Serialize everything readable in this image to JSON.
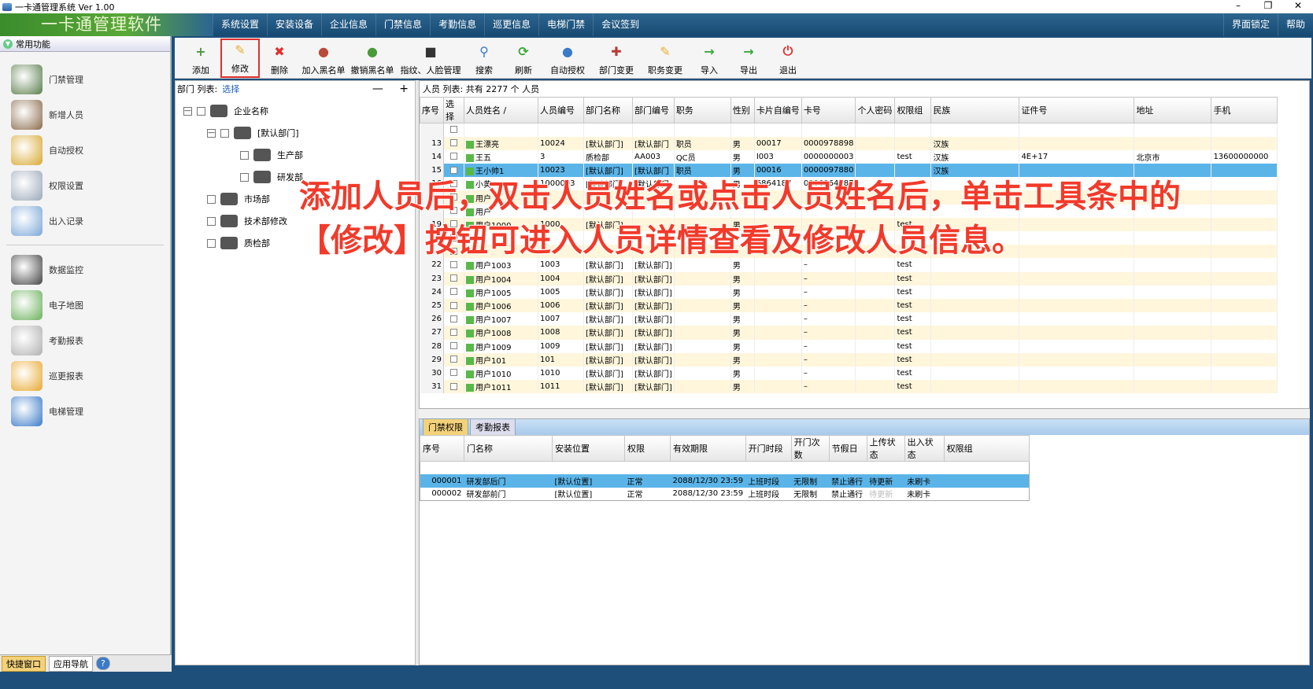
{
  "window": {
    "title": "一卡通管理系统  Ver 1.00",
    "controls": [
      "–",
      "❐",
      "✕"
    ]
  },
  "menubar": {
    "brand": "一卡通管理软件",
    "items": [
      "系统设置",
      "安装设备",
      "企业信息",
      "门禁信息",
      "考勤信息",
      "巡更信息",
      "电梯门禁",
      "会议签到"
    ],
    "right_items": [
      "界面锁定",
      "帮助"
    ]
  },
  "left_panel": {
    "header": "常用功能",
    "items": [
      {
        "label": "门禁管理",
        "icon": "door-access-icon",
        "color": "#5a7d4a"
      },
      {
        "label": "新增人员",
        "icon": "new-person-icon",
        "color": "#8a6a4a"
      },
      {
        "label": "自动授权",
        "icon": "card-icon",
        "color": "#d8a830"
      },
      {
        "label": "权限设置",
        "icon": "permission-icon",
        "color": "#9aa8b8"
      },
      {
        "label": "出入记录",
        "icon": "magnifier-icon",
        "color": "#7aa6d8"
      }
    ],
    "items2": [
      {
        "label": "数据监控",
        "icon": "camera-icon",
        "color": "#444444"
      },
      {
        "label": "电子地图",
        "icon": "map-icon",
        "color": "#6ab05a"
      },
      {
        "label": "考勤报表",
        "icon": "clock-icon",
        "color": "#b0b0b0"
      },
      {
        "label": "巡更报表",
        "icon": "patrol-icon",
        "color": "#e8a830"
      },
      {
        "label": "电梯管理",
        "icon": "elevator-icon",
        "color": "#3a7ac8"
      }
    ],
    "bottom_tabs": [
      "快捷窗口",
      "应用导航",
      "?"
    ]
  },
  "toolbar": {
    "buttons": [
      {
        "label": "添加",
        "icon": "add-person-icon",
        "color": "#4a9a3a"
      },
      {
        "label": "修改",
        "icon": "edit-pencil-icon",
        "color": "#e8b030"
      },
      {
        "label": "删除",
        "icon": "delete-icon",
        "color": "#e03030"
      },
      {
        "label": "加入黑名单",
        "icon": "blacklist-add-icon",
        "color": "#b84a3a"
      },
      {
        "label": "撤销黑名单",
        "icon": "blacklist-remove-icon",
        "color": "#4a9a3a"
      },
      {
        "label": "指纹、人脸管理",
        "icon": "fingerprint-icon",
        "color": "#333333"
      },
      {
        "label": "搜索",
        "icon": "search-icon",
        "color": "#3a7ac8"
      },
      {
        "label": "刷新",
        "icon": "refresh-icon",
        "color": "#3aa83a"
      },
      {
        "label": "自动授权",
        "icon": "auto-auth-icon",
        "color": "#3a7ac8"
      },
      {
        "label": "部门变更",
        "icon": "dept-change-icon",
        "color": "#b83a3a"
      },
      {
        "label": "职务变更",
        "icon": "job-change-icon",
        "color": "#e8b030"
      },
      {
        "label": "导入",
        "icon": "import-icon",
        "color": "#3aa83a"
      },
      {
        "label": "导出",
        "icon": "export-icon",
        "color": "#3aa83a"
      },
      {
        "label": "退出",
        "icon": "power-icon",
        "color": "#e03030"
      }
    ]
  },
  "dept_panel": {
    "label": "部门 列表:",
    "select": "选择",
    "collapse": "—",
    "expand": "+",
    "root": "企业名称",
    "nodes": [
      {
        "label": "[默认部门]",
        "level": 1,
        "exp": "—"
      },
      {
        "label": "生产部",
        "level": 2
      },
      {
        "label": "研发部",
        "level": 2
      },
      {
        "label": "市场部",
        "level": 1
      },
      {
        "label": "技术部修改",
        "level": 1
      },
      {
        "label": "质检部",
        "level": 1
      }
    ]
  },
  "grid": {
    "caption": "人员 列表:    共有 2277  个 人员",
    "columns": [
      "序号",
      "选择",
      "人员姓名 /",
      "人员编号",
      "部门名称",
      "部门编号",
      "职务",
      "性别",
      "卡片自编号",
      "卡号",
      "个人密码",
      "权限组",
      "民族",
      "证件号",
      "地址",
      "手机"
    ],
    "rows": [
      {
        "seq": "",
        "name": "",
        "no": "",
        "dept": "",
        "deptno": "",
        "job": "",
        "sex": "",
        "cardself": "",
        "card": "",
        "pwd": "",
        "group": "",
        "nation": "",
        "id": "",
        "addr": "",
        "phone": "",
        "blank": true
      },
      {
        "seq": "13",
        "name": "王漂亮",
        "no": "10024",
        "dept": "[默认部门]",
        "deptno": "[默认部门",
        "job": "职员",
        "sex": "男",
        "cardself": "00017",
        "card": "0000978898",
        "pwd": "",
        "group": "",
        "nation": "汉族",
        "id": "",
        "addr": "",
        "phone": ""
      },
      {
        "seq": "14",
        "name": "王五",
        "no": "3",
        "dept": "质检部",
        "deptno": "AA003",
        "job": "QC员",
        "sex": "男",
        "cardself": "I003",
        "card": "0000000003",
        "pwd": "",
        "group": "test",
        "nation": "汉族",
        "id": "4E+17",
        "addr": "北京市",
        "phone": "13600000000"
      },
      {
        "seq": "15",
        "name": "王小帅1",
        "no": "10023",
        "dept": "[默认部门]",
        "deptno": "[默认部门",
        "job": "职员",
        "sex": "男",
        "cardself": "00016",
        "card": "0000097880",
        "pwd": "",
        "group": "",
        "nation": "汉族",
        "id": "",
        "addr": "",
        "phone": "",
        "hl": true
      },
      {
        "seq": "16",
        "name": "小黄",
        "no": "1000003",
        "dept": "[默认部门]",
        "deptno": "[默认部门",
        "job": "",
        "sex": "男",
        "cardself": "6864187",
        "card": "0006864187",
        "pwd": "",
        "group": "",
        "nation": "",
        "id": "",
        "addr": "",
        "phone": ""
      },
      {
        "seq": "",
        "name": "用户",
        "no": "",
        "dept": "",
        "deptno": "",
        "job": "",
        "sex": "",
        "cardself": "",
        "card": "",
        "pwd": "",
        "group": "",
        "nation": "",
        "id": "",
        "addr": "",
        "phone": ""
      },
      {
        "seq": "",
        "name": "用户",
        "no": "",
        "dept": "",
        "deptno": "",
        "job": "",
        "sex": "",
        "cardself": "",
        "card": "",
        "pwd": "",
        "group": "",
        "nation": "",
        "id": "",
        "addr": "",
        "phone": ""
      },
      {
        "seq": "19",
        "name": "用户1000",
        "no": "1000",
        "dept": "[默认部门]",
        "deptno": "",
        "job": "",
        "sex": "男",
        "cardself": "",
        "card": "",
        "pwd": "",
        "group": "test",
        "nation": "",
        "id": "",
        "addr": "",
        "phone": ""
      },
      {
        "seq": "",
        "name": "",
        "no": "",
        "dept": "",
        "deptno": "",
        "job": "",
        "sex": "",
        "cardself": "",
        "card": "",
        "pwd": "",
        "group": "",
        "nation": "",
        "id": "",
        "addr": "",
        "phone": ""
      },
      {
        "seq": "",
        "name": "",
        "no": "",
        "dept": "",
        "deptno": "",
        "job": "",
        "sex": "",
        "cardself": "",
        "card": "",
        "pwd": "",
        "group": "",
        "nation": "",
        "id": "",
        "addr": "",
        "phone": ""
      },
      {
        "seq": "22",
        "name": "用户1003",
        "no": "1003",
        "dept": "[默认部门]",
        "deptno": "[默认部门]",
        "job": "",
        "sex": "男",
        "cardself": "",
        "card": "–",
        "pwd": "",
        "group": "test",
        "nation": "",
        "id": "",
        "addr": "",
        "phone": ""
      },
      {
        "seq": "23",
        "name": "用户1004",
        "no": "1004",
        "dept": "[默认部门]",
        "deptno": "[默认部门]",
        "job": "",
        "sex": "男",
        "cardself": "",
        "card": "–",
        "pwd": "",
        "group": "test",
        "nation": "",
        "id": "",
        "addr": "",
        "phone": ""
      },
      {
        "seq": "24",
        "name": "用户1005",
        "no": "1005",
        "dept": "[默认部门]",
        "deptno": "[默认部门]",
        "job": "",
        "sex": "男",
        "cardself": "",
        "card": "–",
        "pwd": "",
        "group": "test",
        "nation": "",
        "id": "",
        "addr": "",
        "phone": ""
      },
      {
        "seq": "25",
        "name": "用户1006",
        "no": "1006",
        "dept": "[默认部门]",
        "deptno": "[默认部门]",
        "job": "",
        "sex": "男",
        "cardself": "",
        "card": "–",
        "pwd": "",
        "group": "test",
        "nation": "",
        "id": "",
        "addr": "",
        "phone": ""
      },
      {
        "seq": "26",
        "name": "用户1007",
        "no": "1007",
        "dept": "[默认部门]",
        "deptno": "[默认部门]",
        "job": "",
        "sex": "男",
        "cardself": "",
        "card": "–",
        "pwd": "",
        "group": "test",
        "nation": "",
        "id": "",
        "addr": "",
        "phone": ""
      },
      {
        "seq": "27",
        "name": "用户1008",
        "no": "1008",
        "dept": "[默认部门]",
        "deptno": "[默认部门]",
        "job": "",
        "sex": "男",
        "cardself": "",
        "card": "–",
        "pwd": "",
        "group": "test",
        "nation": "",
        "id": "",
        "addr": "",
        "phone": ""
      },
      {
        "seq": "28",
        "name": "用户1009",
        "no": "1009",
        "dept": "[默认部门]",
        "deptno": "[默认部门]",
        "job": "",
        "sex": "男",
        "cardself": "",
        "card": "–",
        "pwd": "",
        "group": "test",
        "nation": "",
        "id": "",
        "addr": "",
        "phone": ""
      },
      {
        "seq": "29",
        "name": "用户101",
        "no": "101",
        "dept": "[默认部门]",
        "deptno": "[默认部门]",
        "job": "",
        "sex": "男",
        "cardself": "",
        "card": "–",
        "pwd": "",
        "group": "test",
        "nation": "",
        "id": "",
        "addr": "",
        "phone": ""
      },
      {
        "seq": "30",
        "name": "用户1010",
        "no": "1010",
        "dept": "[默认部门]",
        "deptno": "[默认部门]",
        "job": "",
        "sex": "男",
        "cardself": "",
        "card": "–",
        "pwd": "",
        "group": "test",
        "nation": "",
        "id": "",
        "addr": "",
        "phone": ""
      },
      {
        "seq": "31",
        "name": "用户1011",
        "no": "1011",
        "dept": "[默认部门]",
        "deptno": "[默认部门]",
        "job": "",
        "sex": "男",
        "cardself": "",
        "card": "–",
        "pwd": "",
        "group": "test",
        "nation": "",
        "id": "",
        "addr": "",
        "phone": ""
      }
    ]
  },
  "sub_panel": {
    "tabs": [
      "门禁权限",
      "考勤报表"
    ],
    "columns": [
      "序号",
      "门名称",
      "安装位置",
      "权限",
      "有效期限",
      "开门时段",
      "开门次数",
      "节假日",
      "上传状态",
      "出入状态",
      "权限组"
    ],
    "rows": [
      {
        "seq": "000001",
        "door": "研发部后门",
        "loc": "[默认位置]",
        "perm": "正常",
        "expire": "2088/12/30 23:59",
        "period": "上班时段",
        "count": "无限制",
        "holiday": "禁止通行",
        "upload": "待更新",
        "io": "未刷卡",
        "group": "",
        "hl": true
      },
      {
        "seq": "000002",
        "door": "研发部前门",
        "loc": "[默认位置]",
        "perm": "正常",
        "expire": "2088/12/30 23:59",
        "period": "上班时段",
        "count": "无限制",
        "holiday": "禁止通行",
        "upload": "待更新",
        "io": "未刷卡",
        "group": "",
        "muted": true
      }
    ]
  },
  "overlay": {
    "line1": "添加人员后，双击人员姓名或点击人员姓名后，单击工具条中的",
    "line2": "【修改】按钮可进入人员详情查看及修改人员信息。"
  }
}
